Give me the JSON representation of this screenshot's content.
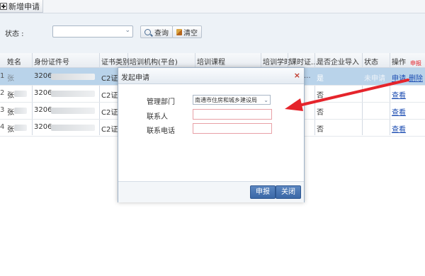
{
  "toolbar": {
    "new_label": "新增申请"
  },
  "search": {
    "status_label": "状态 :",
    "status_value": "",
    "query_label": "查询",
    "clear_label": "清空"
  },
  "table": {
    "headers": [
      "姓名",
      "身份证件号",
      "证书类别",
      "培训机构(平台)",
      "培训课程",
      "培训学时",
      "课时证...",
      "是否企业导入",
      "状态",
      "操作"
    ],
    "rows": [
      {
        "num": "1",
        "name": "张",
        "id": "3206",
        "cert": "C2证",
        "extra": "...",
        "enterprise": "是",
        "status": "未申请",
        "action1": "申请",
        "action2": "删除"
      },
      {
        "num": "2",
        "name": "张",
        "id": "3206",
        "cert": "C2证",
        "extra": "",
        "enterprise": "否",
        "status": "",
        "action1": "查看",
        "action2": ""
      },
      {
        "num": "3",
        "name": "张",
        "id": "3206",
        "cert": "C2证",
        "extra": "",
        "enterprise": "否",
        "status": "",
        "action1": "查看",
        "action2": ""
      },
      {
        "num": "4",
        "name": "张",
        "id": "3206",
        "cert": "C2证",
        "extra": "",
        "enterprise": "否",
        "status": "",
        "action1": "查看",
        "action2": ""
      }
    ]
  },
  "annotation": {
    "label": "申报"
  },
  "dialog": {
    "title": "发起申请",
    "close_glyph": "×",
    "dept_label": "管理部门",
    "dept_value": "南通市住房和城乡建设局",
    "contact_label": "联系人",
    "contact_value": "",
    "phone_label": "联系电话",
    "phone_value": "",
    "submit_label": "申报",
    "close_label": "关闭"
  },
  "colors": {
    "accent": "#3a67a6",
    "selected_row": "#b9d3ea",
    "arrow": "#e5242b",
    "link": "#1f4fb3"
  }
}
